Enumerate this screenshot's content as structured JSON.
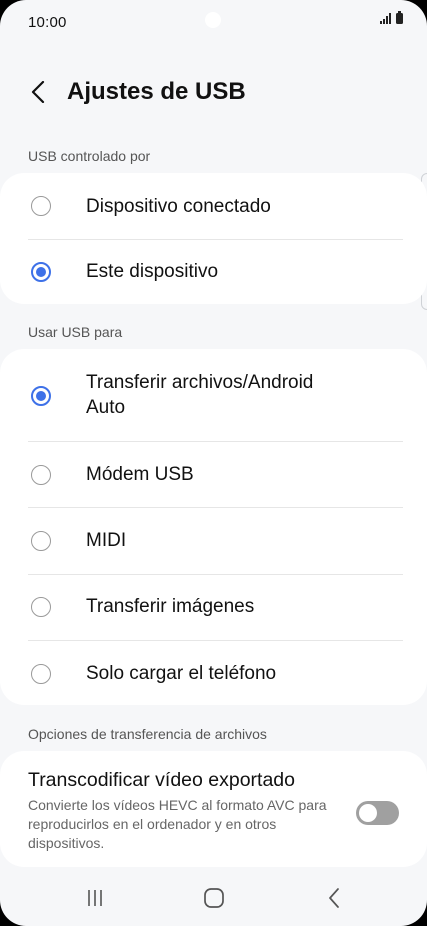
{
  "status_bar": {
    "time": "10:00",
    "icons": [
      "signal-icon",
      "battery-icon"
    ]
  },
  "header": {
    "back_icon": "chevron-left-icon",
    "title": "Ajustes de USB"
  },
  "usb_controlled_by": {
    "label": "USB controlado por",
    "options": [
      {
        "label": "Dispositivo conectado",
        "selected": false
      },
      {
        "label": "Este dispositivo",
        "selected": true
      }
    ]
  },
  "use_usb_for": {
    "label": "Usar USB para",
    "options": [
      {
        "label": "Transferir archivos/Android Auto",
        "selected": true
      },
      {
        "label": "Módem USB",
        "selected": false
      },
      {
        "label": "MIDI",
        "selected": false
      },
      {
        "label": "Transferir imágenes",
        "selected": false
      },
      {
        "label": "Solo cargar el teléfono",
        "selected": false
      }
    ]
  },
  "file_transfer_options": {
    "label": "Opciones de transferencia de archivos",
    "transcode": {
      "title": "Transcodificar vídeo exportado",
      "description": "Convierte los vídeos HEVC al formato AVC para reproducirlos en el ordenador y en otros dispositivos.",
      "enabled": false
    }
  },
  "navbar": {
    "items": [
      "recent-apps-icon",
      "home-icon",
      "back-icon"
    ]
  },
  "colors": {
    "accent": "#3e71e8",
    "background": "#f6f7f9",
    "card": "#ffffff"
  }
}
